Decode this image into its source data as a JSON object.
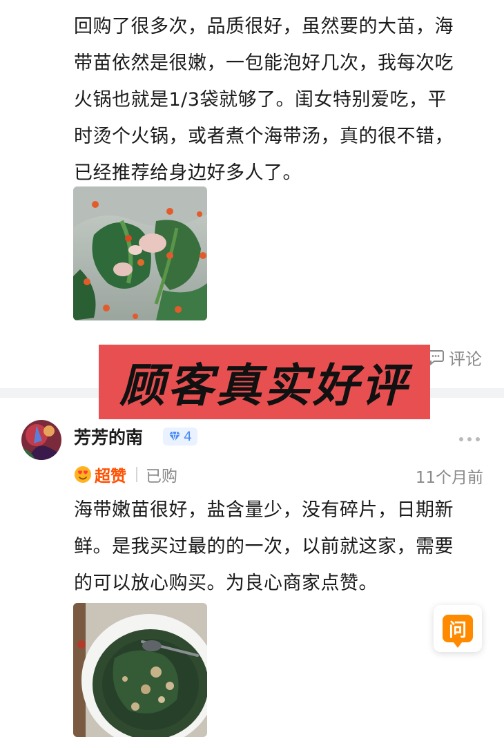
{
  "review1": {
    "text_lines": [
      "回购了很多次，品质很好，虽然要的大苗，海",
      "带苗依然是很嫩，一包能泡好几次，我每次吃",
      "火锅也就是1/3袋就够了。闺女特别爱吃，平",
      "时烫个火锅，或者煮个海带汤，真的很不错，",
      "已经推荐给身边好多人了。"
    ],
    "photo_icon": "seaweed-soup-photo",
    "comment_label": "评论",
    "comment_icon": "comment-bubble-icon"
  },
  "banner": {
    "text": "顾客真实好评",
    "color": "#e84f51"
  },
  "review2": {
    "username": "芳芳的南",
    "level": "4",
    "level_icon": "diamond-icon",
    "rating_emoji": "heart-eyes-emoji",
    "rating_label": "超赞",
    "purchase_status": "已购",
    "time": "11个月前",
    "text_lines": [
      "海带嫩苗很好，盐含量少，没有碎片，日期新",
      "鲜。是我买过最的的一次，以前就这家，需要",
      "的可以放心购买。为良心商家点赞。"
    ],
    "photo_icon": "seaweed-soup-bowl-photo"
  },
  "ask_button": {
    "label": "问",
    "color": "#ff8a00"
  }
}
